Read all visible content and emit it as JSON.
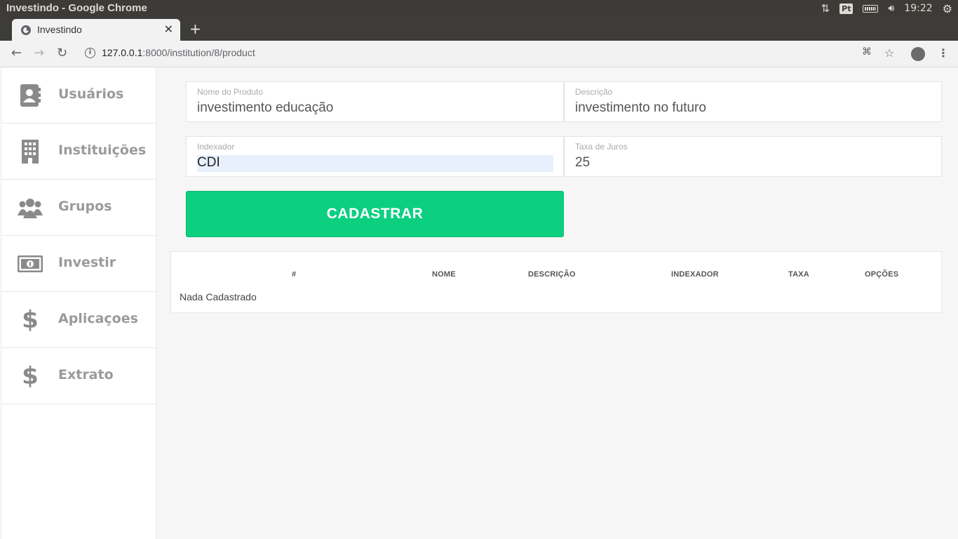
{
  "os": {
    "window_title": "Investindo - Google Chrome",
    "lang": "Pt",
    "time": "19:22"
  },
  "browser": {
    "tab_title": "Investindo",
    "url_host": "127.0.0.1",
    "url_rest": ":8000/institution/8/product"
  },
  "sidebar": {
    "items": [
      {
        "label": "Usuários",
        "icon": "contact-book-icon"
      },
      {
        "label": "Instituições",
        "icon": "building-icon"
      },
      {
        "label": "Grupos",
        "icon": "users-icon"
      },
      {
        "label": "Investir",
        "icon": "money-bill-icon"
      },
      {
        "label": "Aplicaçoes",
        "icon": "dollar-icon"
      },
      {
        "label": "Extrato",
        "icon": "dollar-icon"
      }
    ],
    "dollar_glyph": "$"
  },
  "form": {
    "nome": {
      "label": "Nome do Produto",
      "value": "investimento educação"
    },
    "descricao": {
      "label": "Descrição",
      "value": "investimento no futuro"
    },
    "indexador": {
      "label": "Indexador",
      "value": "CDI"
    },
    "taxa": {
      "label": "Taxa de Juros",
      "value": "25"
    },
    "submit_label": "CADASTRAR",
    "submit_color": "#0ccf80"
  },
  "table": {
    "headers": [
      "#",
      "NOME",
      "DESCRIÇÃO",
      "INDEXADOR",
      "TAXA",
      "OPÇÕES"
    ],
    "empty_text": "Nada Cadastrado"
  }
}
